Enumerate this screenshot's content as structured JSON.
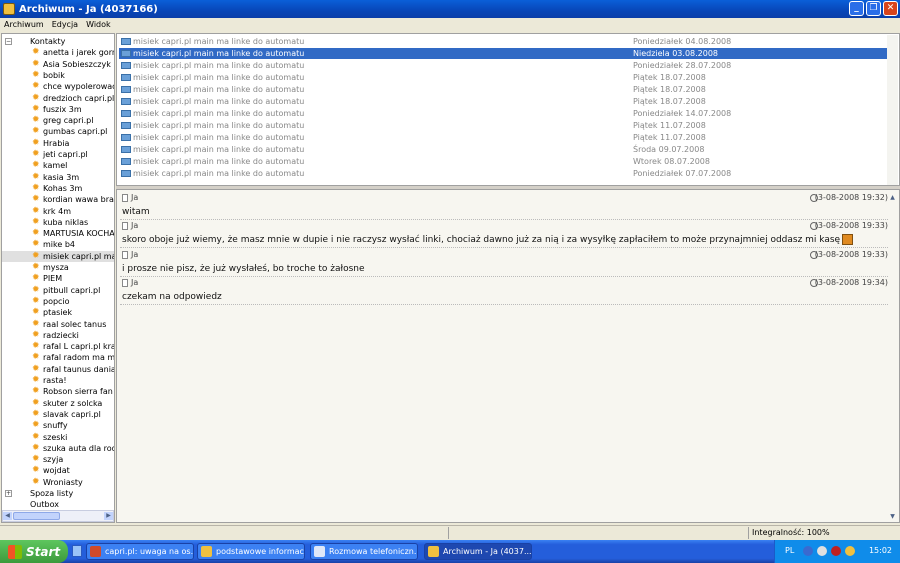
{
  "window": {
    "title": "Archiwum - Ja (4037166)"
  },
  "menu": [
    "Archiwum",
    "Edycja",
    "Widok"
  ],
  "tree": {
    "contacts_label": "Kontakty",
    "contacts": [
      "anetta i jarek gorni",
      "Asia  Sobieszczyk",
      "bobik",
      "chce wypolerowac p",
      "dredzioch capri.pl",
      "fuszix 3m",
      "greg capri.pl",
      "gumbas capri.pl",
      "Hrabia",
      "jeti capri.pl",
      "kamel",
      "kasia 3m",
      "Kohas 3m",
      "kordian wawa bral g",
      "krk 4m",
      "kuba niklas",
      "MARTUSIA KOCHAN",
      "mike b4",
      "misiek capri.pl main n",
      "mysza",
      "PIEM",
      "pitbull capri.pl",
      "popcio",
      "ptasiek",
      "raal solec tanus",
      "radziecki",
      "rafal L capri.pl krakó",
      "rafal radom ma mask",
      "rafal taunus dania",
      "rasta!",
      "Robson sierra fan ch",
      "skuter z solcka",
      "slavak capri.pl",
      "snuffy",
      "szeski",
      "szuka auta dla rodzic",
      "szyja",
      "wojdat",
      "Wroniasty"
    ],
    "selected_contact_index": 18,
    "spoza_label": "Spoza listy",
    "outbox_label": "Outbox"
  },
  "messages": [
    {
      "subject": "misiek capri.pl main ma linke do automatu",
      "date": "Poniedziałek 04.08.2008"
    },
    {
      "subject": "misiek capri.pl main ma linke do automatu",
      "date": "Niedziela 03.08.2008"
    },
    {
      "subject": "misiek capri.pl main ma linke do automatu",
      "date": "Poniedziałek 28.07.2008"
    },
    {
      "subject": "misiek capri.pl main ma linke do automatu",
      "date": "Piątek 18.07.2008"
    },
    {
      "subject": "misiek capri.pl main ma linke do automatu",
      "date": "Piątek 18.07.2008"
    },
    {
      "subject": "misiek capri.pl main ma linke do automatu",
      "date": "Piątek 18.07.2008"
    },
    {
      "subject": "misiek capri.pl main ma linke do automatu",
      "date": "Poniedziałek 14.07.2008"
    },
    {
      "subject": "misiek capri.pl main ma linke do automatu",
      "date": "Piątek 11.07.2008"
    },
    {
      "subject": "misiek capri.pl main ma linke do automatu",
      "date": "Piątek 11.07.2008"
    },
    {
      "subject": "misiek capri.pl main ma linke do automatu",
      "date": "Środa 09.07.2008"
    },
    {
      "subject": "misiek capri.pl main ma linke do automatu",
      "date": "Wtorek 08.07.2008"
    },
    {
      "subject": "misiek capri.pl main ma linke do automatu",
      "date": "Poniedziałek 07.07.2008"
    }
  ],
  "selected_message_index": 1,
  "chat": [
    {
      "author": "Ja",
      "time": "(3-08-2008 19:32)",
      "text": "witam"
    },
    {
      "author": "Ja",
      "time": "(3-08-2008 19:33)",
      "text": "skoro oboje już wiemy, że masz mnie w dupie i nie raczysz wysłać linki, chociaż dawno już za nią i za wysyłkę zapłaciłem to może przynajmniej oddasz mi kasę"
    },
    {
      "author": "Ja",
      "time": "(3-08-2008 19:33)",
      "text": "i prosze nie pisz, że już wysłałeś, bo troche to żałosne"
    },
    {
      "author": "Ja",
      "time": "(3-08-2008 19:34)",
      "text": "czekam na odpowiedz"
    }
  ],
  "status": {
    "integrity": "Integralność: 100%"
  },
  "taskbar": {
    "start_label": "Start",
    "items": [
      {
        "label": "capri.pl: uwaga na os...",
        "color": "#d04a2a"
      },
      {
        "label": "podstawowe informacje",
        "color": "#f0c040"
      },
      {
        "label": "Rozmowa telefoniczn...",
        "color": "#e0e8f8"
      },
      {
        "label": "Archiwum - Ja (4037...",
        "color": "#f0c040",
        "active": true
      }
    ],
    "lang": "PL",
    "clock": "15:02"
  }
}
